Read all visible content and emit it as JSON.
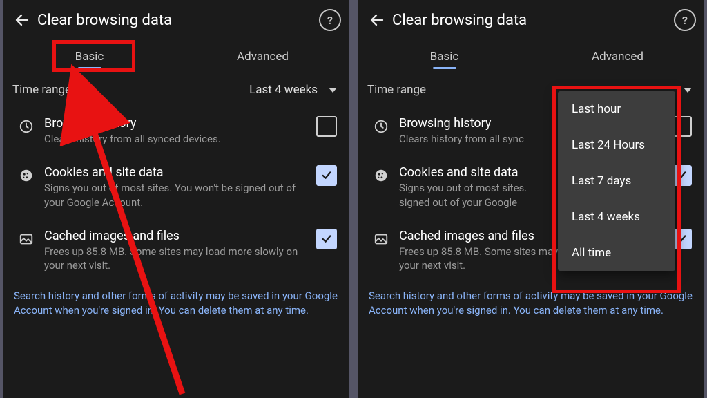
{
  "header": {
    "title": "Clear browsing data"
  },
  "tabs": {
    "basic": "Basic",
    "advanced": "Advanced"
  },
  "time": {
    "label": "Time range",
    "value": "Last 4 weeks"
  },
  "items": [
    {
      "title": "Browsing history",
      "desc": "Clears history from all synced devices.",
      "checked": false
    },
    {
      "title": "Cookies and site data",
      "desc": "Signs you out of most sites. You won't be signed out of your Google Account.",
      "checked": true
    },
    {
      "title": "Cached images and files",
      "desc": "Frees up 85.8 MB. Some sites may load more slowly on your next visit.",
      "checked": true
    }
  ],
  "items_trunc": [
    {
      "title": "Browsing history",
      "desc": "Clears history from all sync"
    },
    {
      "title": "Cookies and site data",
      "desc": "Signs you out of most sites.\nsigned out of your Google"
    },
    {
      "title": "Cached images and files",
      "desc": "Frees up 85.8 MB. Some sites may load more slowly on your next visit."
    }
  ],
  "footer": "Search history and other forms of activity may be saved in your Google Account when you're signed in. You can delete them at any time.",
  "dropdown": [
    "Last hour",
    "Last 24 Hours",
    "Last 7 days",
    "Last 4 weeks",
    "All time"
  ]
}
